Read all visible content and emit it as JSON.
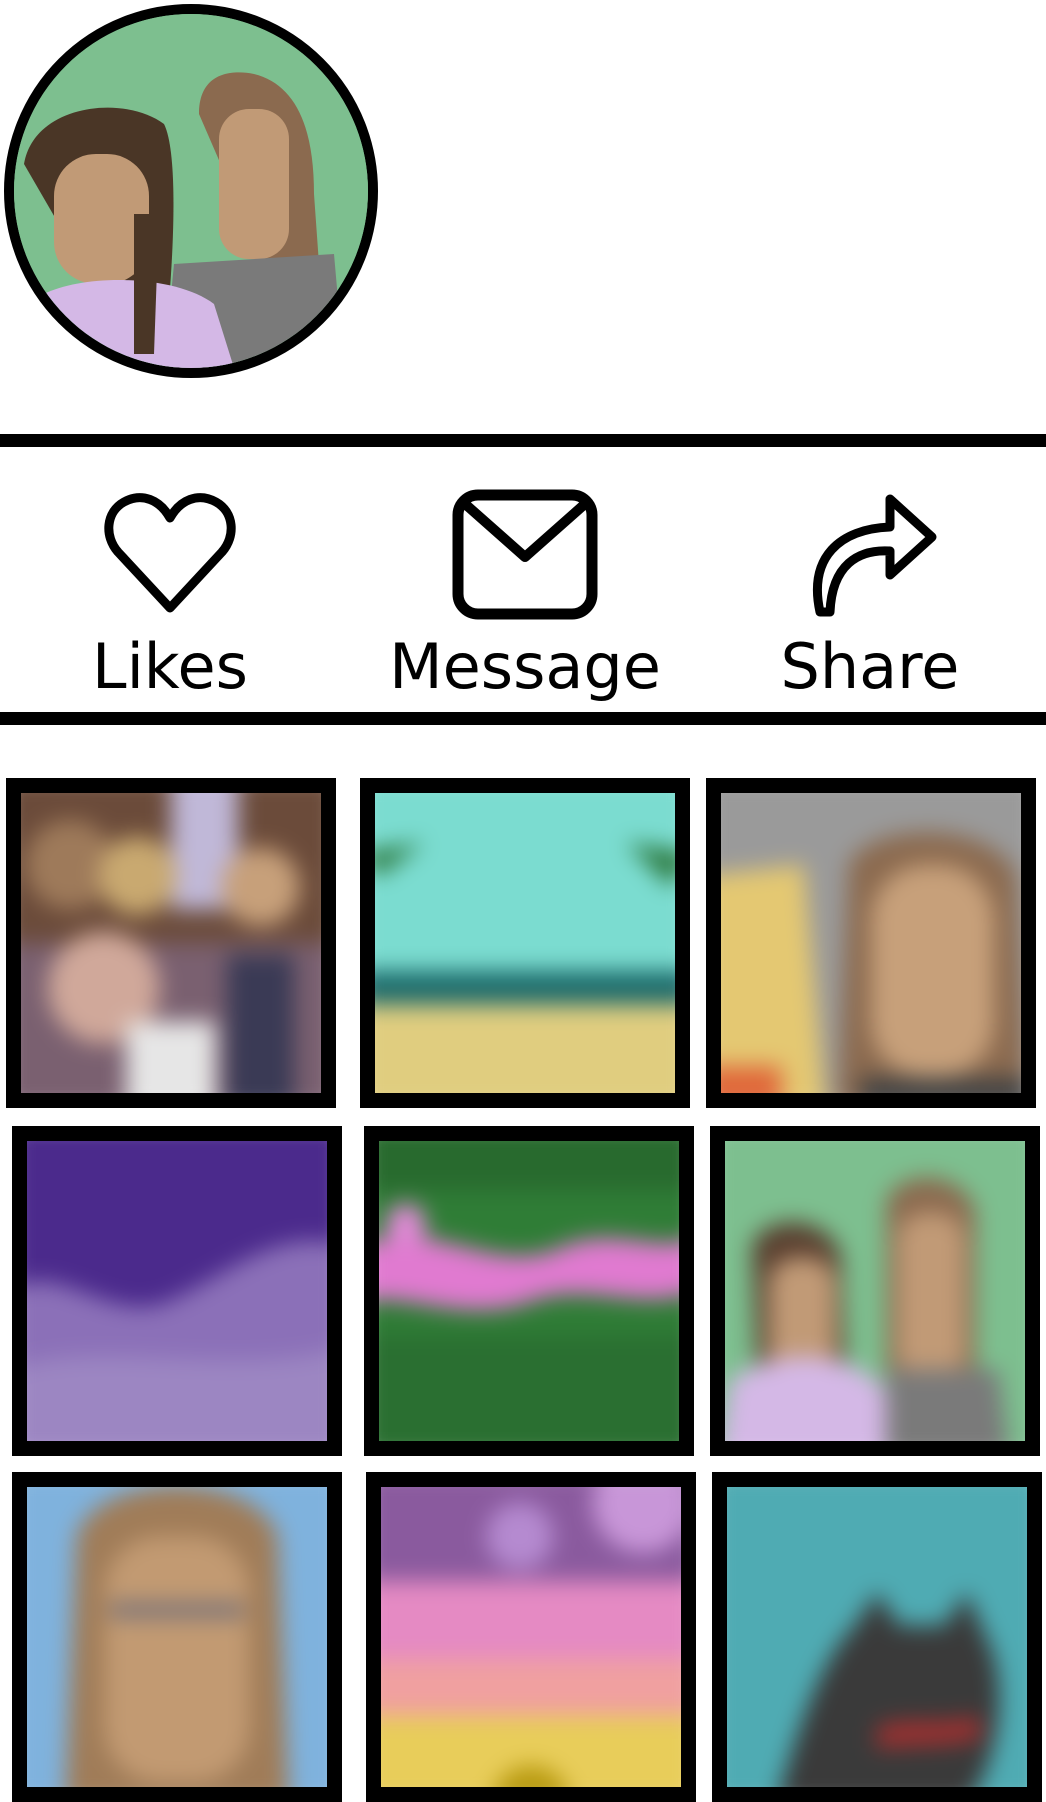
{
  "profile": {
    "avatar_icon": "avatar-two-people-icon"
  },
  "actions": [
    {
      "label": "Likes",
      "icon": "heart-icon"
    },
    {
      "label": "Message",
      "icon": "envelope-icon"
    },
    {
      "label": "Share",
      "icon": "share-arrow-icon"
    }
  ],
  "grid": {
    "photos": [
      {
        "subject": "group-photo",
        "colors": [
          "#6b4b3a",
          "#b89c8c",
          "#e6e6e6"
        ]
      },
      {
        "subject": "beach-palm-trees",
        "colors": [
          "#7bdcd0",
          "#1d6b6b",
          "#e0cd7f"
        ]
      },
      {
        "subject": "two-people-selfie",
        "colors": [
          "#9a9a9a",
          "#e4c872",
          "#c7a07a"
        ]
      },
      {
        "subject": "purple-mountains",
        "colors": [
          "#4b2a8c",
          "#8b70b8"
        ]
      },
      {
        "subject": "pink-flowers-green",
        "colors": [
          "#2f7d36",
          "#e07ad0"
        ]
      },
      {
        "subject": "two-people-green-background",
        "colors": [
          "#7dbf8f",
          "#d4b8e6",
          "#7a7a7a"
        ]
      },
      {
        "subject": "person-portrait-blue",
        "colors": [
          "#7fb2dd",
          "#c29a72"
        ]
      },
      {
        "subject": "sunset-sky",
        "colors": [
          "#8a5a9e",
          "#e58ac3",
          "#e8cd5a"
        ]
      },
      {
        "subject": "cat-teal-background",
        "colors": [
          "#4fabb3",
          "#3a3a3a"
        ]
      }
    ]
  }
}
